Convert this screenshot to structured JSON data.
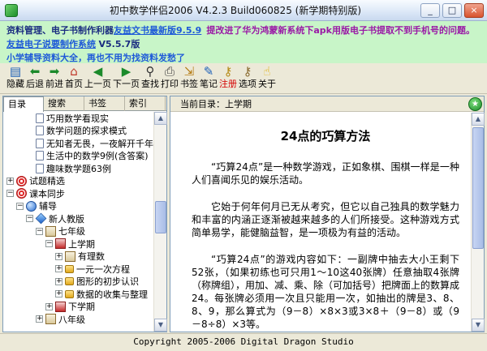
{
  "window": {
    "title": "初中数学伴侣2006 V4.2.3 Build060825   (新学期特别版)",
    "buttons": {
      "minimize": "_",
      "maximize": "□",
      "close": "×"
    }
  },
  "banner": {
    "line1_prefix": "资料管理、电子书制作利器",
    "line1_link": "友益文书最新版9.5.9",
    "line1_notice": "提改进了华为鸿蒙新系统下apk用版电子书提取不到手机号的问题。",
    "line2_link": "友益电子说要制作系统",
    "line2_version": "V5.5.7版",
    "line3": "小学辅导资料大全，再也不用为找资料发愁了"
  },
  "toolbar": {
    "items": [
      {
        "label": "隐藏",
        "icon": "hide-icon",
        "glyph": "▤",
        "color": "#1b5fb8",
        "red": false
      },
      {
        "label": "后退",
        "icon": "back-arrow-icon",
        "glyph": "⬅",
        "color": "#1b8a2a",
        "red": false
      },
      {
        "label": "前进",
        "icon": "forward-arrow-icon",
        "glyph": "➡",
        "color": "#1b8a2a",
        "red": false
      },
      {
        "label": "首页",
        "icon": "home-icon",
        "glyph": "⌂",
        "color": "#c0392b",
        "red": false
      },
      {
        "label": "上一页",
        "icon": "previous-page-icon",
        "glyph": "◀",
        "color": "#1b8a2a",
        "red": false
      },
      {
        "label": "下一页",
        "icon": "next-page-icon",
        "glyph": "▶",
        "color": "#1b8a2a",
        "red": false
      },
      {
        "label": "查找",
        "icon": "binoculars-icon",
        "glyph": "⚲",
        "color": "#333333",
        "red": false
      },
      {
        "label": "打印",
        "icon": "printer-icon",
        "glyph": "⎙",
        "color": "#444444",
        "red": false
      },
      {
        "label": "书签",
        "icon": "bookmark-icon",
        "glyph": "⇲",
        "color": "#b57d16",
        "red": false
      },
      {
        "label": "笔记",
        "icon": "notes-pen-icon",
        "glyph": "✎",
        "color": "#1b5fb8",
        "red": false
      },
      {
        "label": "注册",
        "icon": "key-icon",
        "glyph": "⚷",
        "color": "#b58a16",
        "red": true
      },
      {
        "label": "选项",
        "icon": "options-key-icon",
        "glyph": "⚷",
        "color": "#8a6b2f",
        "red": false
      },
      {
        "label": "关于",
        "icon": "about-pointer-icon",
        "glyph": "☝",
        "color": "#e0b010",
        "red": false
      }
    ]
  },
  "left_tabs": [
    "目录",
    "搜索",
    "书签",
    "索引"
  ],
  "tree": [
    {
      "label": "巧用数学看现实",
      "level": 2,
      "expander": "",
      "icon": "doc"
    },
    {
      "label": "数学问题的探求模式",
      "level": 2,
      "expander": "",
      "icon": "doc"
    },
    {
      "label": "无知者无畏，一夜解开千年数学",
      "level": 2,
      "expander": "",
      "icon": "doc"
    },
    {
      "label": "生活中的数学9例(含答案)",
      "level": 2,
      "expander": "",
      "icon": "doc"
    },
    {
      "label": "趣味数学题63例",
      "level": 2,
      "expander": "",
      "icon": "doc"
    },
    {
      "label": "试题精选",
      "level": 0,
      "expander": "+",
      "icon": "target"
    },
    {
      "label": "课本同步",
      "level": 0,
      "expander": "−",
      "icon": "target"
    },
    {
      "label": "辅导",
      "level": 1,
      "expander": "−",
      "icon": "globe"
    },
    {
      "label": "新人教版",
      "level": 2,
      "expander": "−",
      "icon": "gem"
    },
    {
      "label": "七年级",
      "level": 3,
      "expander": "−",
      "icon": "book"
    },
    {
      "label": "上学期",
      "level": 4,
      "expander": "−",
      "icon": "book-red"
    },
    {
      "label": "有理数",
      "level": 5,
      "expander": "+",
      "icon": "book"
    },
    {
      "label": "一元一次方程",
      "level": 5,
      "expander": "+",
      "icon": "lock"
    },
    {
      "label": "图形的初步认识",
      "level": 5,
      "expander": "+",
      "icon": "lock"
    },
    {
      "label": "数据的收集与整理",
      "level": 5,
      "expander": "+",
      "icon": "lock"
    },
    {
      "label": "下学期",
      "level": 4,
      "expander": "+",
      "icon": "book-red"
    },
    {
      "label": "八年级",
      "level": 3,
      "expander": "+",
      "icon": "book"
    }
  ],
  "content": {
    "position_label": "当前目录：上学期",
    "title": "24点的巧算方法",
    "paragraphs": [
      "“巧算24点”是一种数学游戏，正如象棋、围棋一样是一种人们喜闻乐见的娱乐活动。",
      "它始于何年何月已无从考究，但它以自己独具的数学魅力和丰富的内涵正逐渐被越来越多的人们所接受。这种游戏方式简单易学，能健脑益智，是一项极为有益的活动。",
      "“巧算24点”的游戏内容如下：一副牌中抽去大小王剩下52张，（如果初练也可只用1～10这40张牌）任意抽取4张牌（称牌组），用加、减、乘、除（可加括号）把牌面上的数算成24。每张牌必须用一次且只能用一次，如抽出的牌是3、8、8、9，那么算式为（9－8）×8×3或3×8＋（9－8）或（9－8÷8）×3等。"
    ]
  },
  "status": "Copyright 2005-2006 Digital Dragon Studio"
}
